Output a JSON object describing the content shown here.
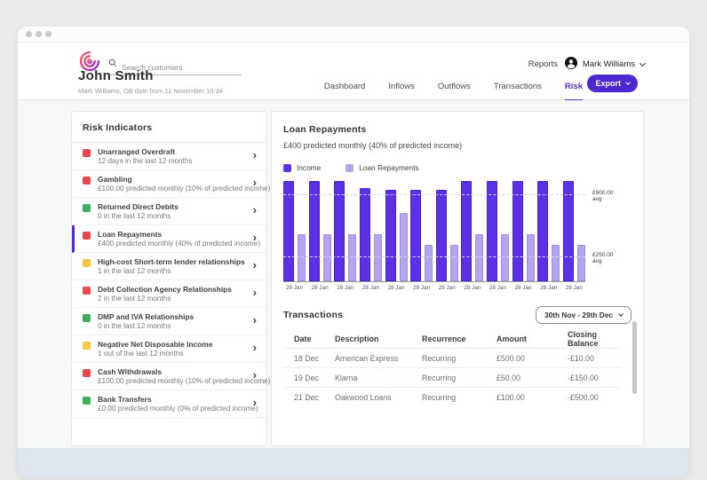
{
  "header": {
    "search_placeholder": "Search customers",
    "reports_label": "Reports",
    "user_name": "Mark Williams"
  },
  "customer": {
    "name": "John Smith",
    "subtitle": "Mark Williams, OB date from 11 November 10:34"
  },
  "nav": {
    "tabs": [
      "Dashboard",
      "Inflows",
      "Outflows",
      "Transactions",
      "Risk"
    ],
    "active": "Risk",
    "export_label": "Export"
  },
  "risk_panel": {
    "title": "Risk Indicators",
    "items": [
      {
        "status": "red",
        "title": "Unarranged Overdraft",
        "subtitle": "12 days in the last 12 months",
        "selected": false
      },
      {
        "status": "red",
        "title": "Gambling",
        "subtitle": "£100.00 predicted monthly (10% of predicted income)",
        "selected": false
      },
      {
        "status": "green",
        "title": "Returned Direct Debits",
        "subtitle": "0 in the last 12 months",
        "selected": false
      },
      {
        "status": "red",
        "title": "Loan Repayments",
        "subtitle": "£400 predicted monthly (40% of predicted income)",
        "selected": true
      },
      {
        "status": "yellow",
        "title": "High-cost Short-term lender relationships",
        "subtitle": "1 in the last 12 months",
        "selected": false
      },
      {
        "status": "red",
        "title": "Debt Collection Agency Relationships",
        "subtitle": "2 in the last 12 months",
        "selected": false
      },
      {
        "status": "green",
        "title": "DMP and IVA Relationships",
        "subtitle": "0 in the last 12 months",
        "selected": false
      },
      {
        "status": "yellow",
        "title": "Negative Net Disposable Income",
        "subtitle": "1 out of the last 12 months",
        "selected": false
      },
      {
        "status": "red",
        "title": "Cash Withdrawals",
        "subtitle": "£100.00 predicted monthly (10% of predicted income)",
        "selected": false
      },
      {
        "status": "green",
        "title": "Bank Transfers",
        "subtitle": "£0.00 predicted monthly (0% of predicted income)",
        "selected": false
      }
    ]
  },
  "chart_panel": {
    "title": "Loan Repayments",
    "subtitle": "£400 predicted monthly (40% of predicted income)",
    "legend": [
      {
        "label": "Income",
        "color": "#5b30e6"
      },
      {
        "label": "Loan Repayments",
        "color": "#b5a5f0"
      }
    ]
  },
  "chart_data": {
    "type": "bar",
    "title": "Loan Repayments",
    "categories": [
      "28 Jan",
      "28 Jan",
      "28 Jan",
      "28 Jan",
      "28 Jan",
      "28 Jan",
      "28 Jan",
      "28 Jan",
      "28 Jan",
      "28 Jan",
      "28 Jan",
      "28 Jan"
    ],
    "series": [
      {
        "name": "Income",
        "color": "#5b30e6",
        "border": "#4824cf",
        "values": [
          1050,
          1050,
          1050,
          980,
          955,
          960,
          955,
          1050,
          1050,
          1050,
          1050,
          1050
        ]
      },
      {
        "name": "Loan Repayments",
        "color": "#b5a5f0",
        "border": "#a violet",
        "values": [
          490,
          490,
          490,
          490,
          715,
          380,
          380,
          490,
          490,
          490,
          380,
          380
        ]
      }
    ],
    "annotations": [
      {
        "label": "£900.00",
        "sublabel": "avg",
        "value": 900
      },
      {
        "label": "£250.00",
        "sublabel": "avg",
        "value": 250
      }
    ],
    "ylim": [
      0,
      1100
    ],
    "legend_position": "top-left",
    "grid": "avg-dashed-lines-only"
  },
  "transactions": {
    "title": "Transactions",
    "date_range": "30th Nov - 29th Dec",
    "columns": [
      "Date",
      "Description",
      "Recurrence",
      "Amount",
      "Closing Balance"
    ],
    "rows": [
      [
        "18 Dec",
        "American Express",
        "Recurring",
        "£500.00",
        "-£10.00"
      ],
      [
        "19 Dec",
        "Klarna",
        "Recurring",
        "£50.00",
        "-£150.00"
      ],
      [
        "21 Dec",
        "Oakwood Loans",
        "Recurring",
        "£100.00",
        "-£500.00"
      ]
    ]
  },
  "colors": {
    "accent": "#4b28d0",
    "income_bar": "#5b30e6",
    "income_bar_border": "#4824cf",
    "loan_bar": "#b5a5f0",
    "loan_bar_border": "#a08fe0",
    "avg_line": "#d8d1f7",
    "status": {
      "red": "#e84750",
      "green": "#3fae5f",
      "yellow": "#f6c744"
    },
    "window_footer": "#dfe6ef"
  }
}
